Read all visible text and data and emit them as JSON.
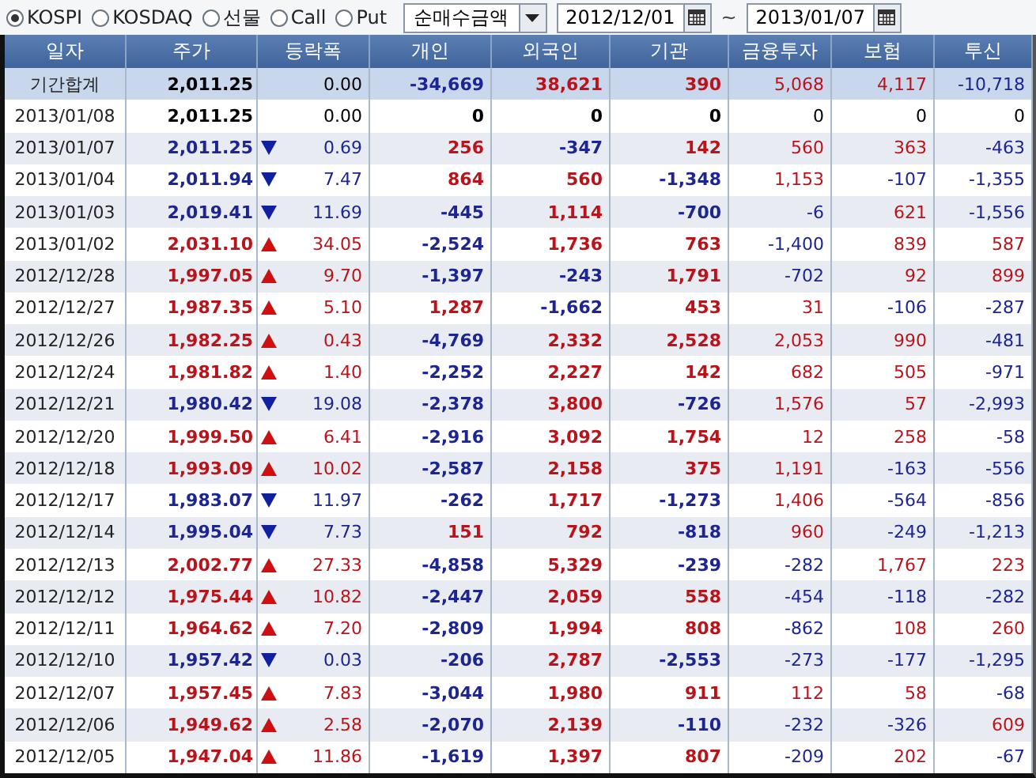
{
  "toolbar": {
    "markets": [
      {
        "label": "KOSPI",
        "selected": true
      },
      {
        "label": "KOSDAQ",
        "selected": false
      },
      {
        "label": "선물",
        "selected": false
      },
      {
        "label": "Call",
        "selected": false
      },
      {
        "label": "Put",
        "selected": false
      }
    ],
    "measure": {
      "value": "순매수금액"
    },
    "start_date": "2012/12/01",
    "separator": "~",
    "end_date": "2013/01/07"
  },
  "table": {
    "columns": [
      "일자",
      "주가",
      "등락폭",
      "개인",
      "외국인",
      "기관",
      "금융투자",
      "보험",
      "투신"
    ],
    "summary": {
      "date": "기간합계",
      "price": "2,011.25",
      "kind": "flat",
      "change": "0.00",
      "values": [
        "-34,669",
        "38,621",
        "390",
        "5,068",
        "4,117",
        "-10,718"
      ]
    },
    "rows": [
      {
        "date": "2013/01/08",
        "price": "2,011.25",
        "kind": "flat",
        "change": "0.00",
        "values": [
          "0",
          "0",
          "0",
          "0",
          "0",
          "0"
        ]
      },
      {
        "date": "2013/01/07",
        "price": "2,011.25",
        "kind": "down",
        "change": "0.69",
        "values": [
          "256",
          "-347",
          "142",
          "560",
          "363",
          "-463"
        ]
      },
      {
        "date": "2013/01/04",
        "price": "2,011.94",
        "kind": "down",
        "change": "7.47",
        "values": [
          "864",
          "560",
          "-1,348",
          "1,153",
          "-107",
          "-1,355"
        ]
      },
      {
        "date": "2013/01/03",
        "price": "2,019.41",
        "kind": "down",
        "change": "11.69",
        "values": [
          "-445",
          "1,114",
          "-700",
          "-6",
          "621",
          "-1,556"
        ]
      },
      {
        "date": "2013/01/02",
        "price": "2,031.10",
        "kind": "up",
        "change": "34.05",
        "values": [
          "-2,524",
          "1,736",
          "763",
          "-1,400",
          "839",
          "587"
        ]
      },
      {
        "date": "2012/12/28",
        "price": "1,997.05",
        "kind": "up",
        "change": "9.70",
        "values": [
          "-1,397",
          "-243",
          "1,791",
          "-702",
          "92",
          "899"
        ]
      },
      {
        "date": "2012/12/27",
        "price": "1,987.35",
        "kind": "up",
        "change": "5.10",
        "values": [
          "1,287",
          "-1,662",
          "453",
          "31",
          "-106",
          "-287"
        ]
      },
      {
        "date": "2012/12/26",
        "price": "1,982.25",
        "kind": "up",
        "change": "0.43",
        "values": [
          "-4,769",
          "2,332",
          "2,528",
          "2,053",
          "990",
          "-481"
        ]
      },
      {
        "date": "2012/12/24",
        "price": "1,981.82",
        "kind": "up",
        "change": "1.40",
        "values": [
          "-2,252",
          "2,227",
          "142",
          "682",
          "505",
          "-971"
        ]
      },
      {
        "date": "2012/12/21",
        "price": "1,980.42",
        "kind": "down",
        "change": "19.08",
        "values": [
          "-2,378",
          "3,800",
          "-726",
          "1,576",
          "57",
          "-2,993"
        ]
      },
      {
        "date": "2012/12/20",
        "price": "1,999.50",
        "kind": "up",
        "change": "6.41",
        "values": [
          "-2,916",
          "3,092",
          "1,754",
          "12",
          "258",
          "-58"
        ]
      },
      {
        "date": "2012/12/18",
        "price": "1,993.09",
        "kind": "up",
        "change": "10.02",
        "values": [
          "-2,587",
          "2,158",
          "375",
          "1,191",
          "-163",
          "-556"
        ]
      },
      {
        "date": "2012/12/17",
        "price": "1,983.07",
        "kind": "down",
        "change": "11.97",
        "values": [
          "-262",
          "1,717",
          "-1,273",
          "1,406",
          "-564",
          "-856"
        ]
      },
      {
        "date": "2012/12/14",
        "price": "1,995.04",
        "kind": "down",
        "change": "7.73",
        "values": [
          "151",
          "792",
          "-818",
          "960",
          "-249",
          "-1,213"
        ]
      },
      {
        "date": "2012/12/13",
        "price": "2,002.77",
        "kind": "up",
        "change": "27.33",
        "values": [
          "-4,858",
          "5,329",
          "-239",
          "-282",
          "1,767",
          "223"
        ]
      },
      {
        "date": "2012/12/12",
        "price": "1,975.44",
        "kind": "up",
        "change": "10.82",
        "values": [
          "-2,447",
          "2,059",
          "558",
          "-454",
          "-118",
          "-282"
        ]
      },
      {
        "date": "2012/12/11",
        "price": "1,964.62",
        "kind": "up",
        "change": "7.20",
        "values": [
          "-2,809",
          "1,994",
          "808",
          "-862",
          "108",
          "260"
        ]
      },
      {
        "date": "2012/12/10",
        "price": "1,957.42",
        "kind": "down",
        "change": "0.03",
        "values": [
          "-206",
          "2,787",
          "-2,553",
          "-273",
          "-177",
          "-1,295"
        ]
      },
      {
        "date": "2012/12/07",
        "price": "1,957.45",
        "kind": "up",
        "change": "7.83",
        "values": [
          "-3,044",
          "1,980",
          "911",
          "112",
          "58",
          "-68"
        ]
      },
      {
        "date": "2012/12/06",
        "price": "1,949.62",
        "kind": "up",
        "change": "2.58",
        "values": [
          "-2,070",
          "2,139",
          "-110",
          "-232",
          "-326",
          "609"
        ]
      },
      {
        "date": "2012/12/05",
        "price": "1,947.04",
        "kind": "up",
        "change": "11.86",
        "values": [
          "-1,619",
          "1,397",
          "807",
          "-209",
          "202",
          "-67"
        ]
      }
    ]
  }
}
